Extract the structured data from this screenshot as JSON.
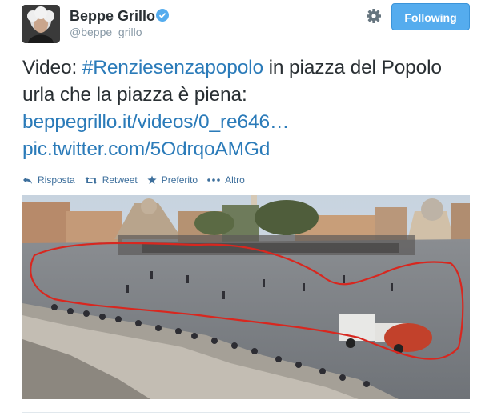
{
  "user": {
    "name": "Beppe Grillo",
    "handle": "@beppe_grillo",
    "verified": true
  },
  "follow_button": {
    "label": "Following",
    "color": "#55acee"
  },
  "tweet": {
    "prefix": "Video: ",
    "hashtag": "#Renziesenzapopolo",
    "middle": " in piazza del Popolo urla che la piazza è piena: ",
    "link1": "beppegrillo.it/videos/0_re646…",
    "link2": "pic.twitter.com/5OdrqoAMGd",
    "link_color": "#2b7bb9"
  },
  "actions": {
    "reply": "Risposta",
    "retweet": "Retweet",
    "favorite": "Preferito",
    "more": "Altro"
  },
  "icons": [
    "verified-icon",
    "gear-icon",
    "reply-icon",
    "retweet-icon",
    "star-icon",
    "more-icon"
  ]
}
